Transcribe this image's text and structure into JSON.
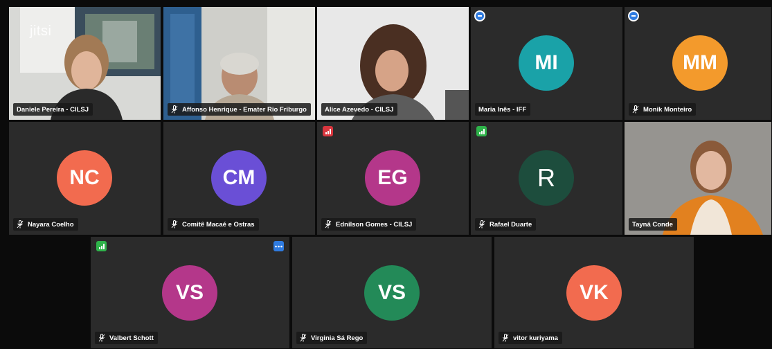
{
  "app": {
    "logo_text": "jitsi"
  },
  "colors": {
    "tile_bg": "#2b2b2b",
    "stage_bg": "#0b0b0b",
    "active_border": "#4a8fe0",
    "signal_good": "#2eb34a",
    "signal_bad": "#d9363e",
    "menu_blue": "#2f7be0"
  },
  "participants": [
    {
      "name": "Daniele Pereira - CILSJ",
      "type": "video",
      "muted": false,
      "active_speaker": true
    },
    {
      "name": "Affonso Henrique - Emater Rio Friburgo",
      "type": "video",
      "muted": true
    },
    {
      "name": "Alice Azevedo - CILSJ",
      "type": "video",
      "muted": false
    },
    {
      "name": "Maria Inês - IFF",
      "initials": "MI",
      "avatar_color": "#1aa2a8",
      "muted": false,
      "indicator": "status-icon"
    },
    {
      "name": "Monik Monteiro",
      "initials": "MM",
      "avatar_color": "#f39a2c",
      "muted": true,
      "indicator": "status-icon"
    },
    {
      "name": "Nayara Coelho",
      "initials": "NC",
      "avatar_color": "#f26b4f",
      "muted": true
    },
    {
      "name": "Comitê Macaé e Ostras",
      "initials": "CM",
      "avatar_color": "#6a4fd6",
      "muted": true
    },
    {
      "name": "Ednilson Gomes - CILSJ",
      "initials": "EG",
      "avatar_color": "#b4378a",
      "muted": true,
      "indicator": "signal-weak-icon"
    },
    {
      "name": "Rafael Duarte",
      "initials": "R",
      "avatar_color": "#1d4d3d",
      "muted": true,
      "indicator": "signal-good-icon"
    },
    {
      "name": "Tayná Conde",
      "type": "video",
      "muted": false
    },
    {
      "name": "Valbert Schott",
      "initials": "VS",
      "avatar_color": "#b4378a",
      "muted": true,
      "indicator": "signal-good-icon",
      "menu_icon": "more-options-icon"
    },
    {
      "name": "Virginia Sá Rego",
      "initials": "VS",
      "avatar_color": "#238a58",
      "muted": true
    },
    {
      "name": "vitor kuriyama",
      "initials": "VK",
      "avatar_color": "#f26b4f",
      "muted": true
    }
  ]
}
